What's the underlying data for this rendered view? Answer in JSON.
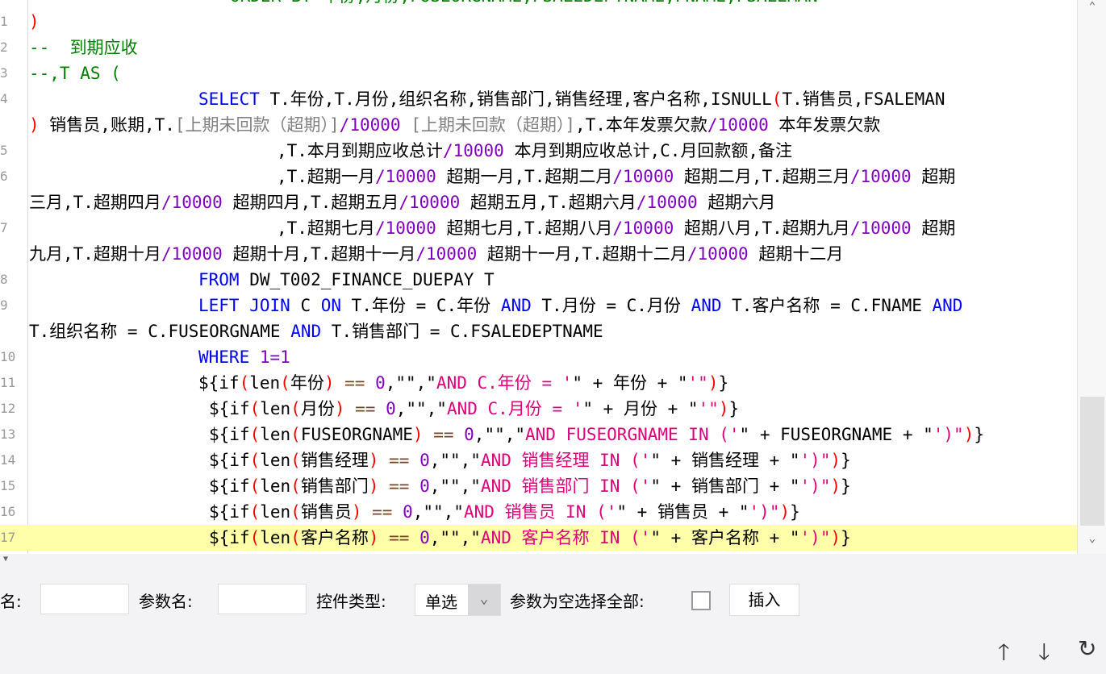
{
  "code": {
    "rows": [
      {
        "num": "",
        "tokens": [
          [
            "ORDER BY 年份,月份,FUSEORGNAME,FSALEDEPTNAME,FNAME,FSALEMAN",
            "cmt"
          ]
        ]
      },
      {
        "num": "1",
        "tokens": [
          [
            ")",
            "red"
          ]
        ]
      },
      {
        "num": "2",
        "tokens": [
          [
            "--  到期应收",
            "cmt"
          ]
        ]
      },
      {
        "num": "3",
        "tokens": [
          [
            "--,T AS (",
            "cmt"
          ]
        ]
      },
      {
        "num": "4",
        "tokens": [
          [
            "SELECT",
            "kw"
          ],
          [
            " T.年份,T.月份,组织名称,销售部门,销售经理,客户名称,ISNULL",
            "txt"
          ],
          [
            "(",
            "red"
          ],
          [
            "T.销售员,FSALEMAN",
            "txt"
          ]
        ]
      },
      {
        "num": "",
        "tokens": [
          [
            ")",
            "red"
          ],
          [
            " 销售员,账期,T.",
            "txt"
          ],
          [
            "[上期未回款（超期）]",
            "gray"
          ],
          [
            "/10000",
            "num"
          ],
          [
            " ",
            "txt"
          ],
          [
            "[上期未回款（超期）]",
            "gray"
          ],
          [
            ",T.本年发票欠款",
            "txt"
          ],
          [
            "/10000",
            "num"
          ],
          [
            " 本年发票欠款",
            "txt"
          ]
        ]
      },
      {
        "num": "5",
        "tokens": [
          [
            ",T.本月到期应收总计",
            "txt"
          ],
          [
            "/10000",
            "num"
          ],
          [
            " 本月到期应收总计,C.月回款额,备注",
            "txt"
          ]
        ]
      },
      {
        "num": "6",
        "tokens": [
          [
            ",T.超期一月",
            "txt"
          ],
          [
            "/10000",
            "num"
          ],
          [
            " 超期一月,T.超期二月",
            "txt"
          ],
          [
            "/10000",
            "num"
          ],
          [
            " 超期二月,T.超期三月",
            "txt"
          ],
          [
            "/10000",
            "num"
          ],
          [
            " 超期",
            "txt"
          ]
        ]
      },
      {
        "num": "",
        "tokens": [
          [
            "三月,T.超期四月",
            "txt"
          ],
          [
            "/10000",
            "num"
          ],
          [
            " 超期四月,T.超期五月",
            "txt"
          ],
          [
            "/10000",
            "num"
          ],
          [
            " 超期五月,T.超期六月",
            "txt"
          ],
          [
            "/10000",
            "num"
          ],
          [
            " 超期六月",
            "txt"
          ]
        ]
      },
      {
        "num": "7",
        "tokens": [
          [
            ",T.超期七月",
            "txt"
          ],
          [
            "/10000",
            "num"
          ],
          [
            " 超期七月,T.超期八月",
            "txt"
          ],
          [
            "/10000",
            "num"
          ],
          [
            " 超期八月,T.超期九月",
            "txt"
          ],
          [
            "/10000",
            "num"
          ],
          [
            " 超期",
            "txt"
          ]
        ]
      },
      {
        "num": "",
        "tokens": [
          [
            "九月,T.超期十月",
            "txt"
          ],
          [
            "/10000",
            "num"
          ],
          [
            " 超期十月,T.超期十一月",
            "txt"
          ],
          [
            "/10000",
            "num"
          ],
          [
            " 超期十一月,T.超期十二月",
            "txt"
          ],
          [
            "/10000",
            "num"
          ],
          [
            " 超期十二月",
            "txt"
          ]
        ]
      },
      {
        "num": "8",
        "tokens": [
          [
            "FROM",
            "kw"
          ],
          [
            " DW_T002_FINANCE_DUEPAY T",
            "txt"
          ]
        ]
      },
      {
        "num": "9",
        "tokens": [
          [
            "LEFT JOIN",
            "kw"
          ],
          [
            " C ",
            "txt"
          ],
          [
            "ON",
            "kw"
          ],
          [
            " T.年份 = C.年份 ",
            "txt"
          ],
          [
            "AND",
            "kw"
          ],
          [
            " T.月份 = C.月份 ",
            "txt"
          ],
          [
            "AND",
            "kw"
          ],
          [
            " T.客户名称 = C.FNAME ",
            "txt"
          ],
          [
            "AND",
            "kw"
          ]
        ]
      },
      {
        "num": "",
        "tokens": [
          [
            "T.组织名称 = C.FUSEORGNAME ",
            "txt"
          ],
          [
            "AND",
            "kw"
          ],
          [
            " T.销售部门 = C.FSALEDEPTNAME",
            "txt"
          ]
        ]
      },
      {
        "num": "10",
        "tokens": [
          [
            "WHERE",
            "kw"
          ],
          [
            " 1=1",
            "num"
          ]
        ]
      },
      {
        "num": "11",
        "tokens": [
          [
            "${if",
            "txt"
          ],
          [
            "(",
            "red"
          ],
          [
            "len",
            "txt"
          ],
          [
            "(",
            "red"
          ],
          [
            "年份",
            "txt"
          ],
          [
            ")",
            "red"
          ],
          [
            " == ",
            "op"
          ],
          [
            "0",
            "num"
          ],
          [
            ",\"\",\"",
            "txt"
          ],
          [
            "AND C.年份 = '",
            "str"
          ],
          [
            "\" + 年份 + \"",
            "txt"
          ],
          [
            "'\"",
            "str"
          ],
          [
            ")",
            "red"
          ],
          [
            "}",
            "txt"
          ]
        ]
      },
      {
        "num": "12",
        "tokens": [
          [
            "${if",
            "txt"
          ],
          [
            "(",
            "red"
          ],
          [
            "len",
            "txt"
          ],
          [
            "(",
            "red"
          ],
          [
            "月份",
            "txt"
          ],
          [
            ")",
            "red"
          ],
          [
            " == ",
            "op"
          ],
          [
            "0",
            "num"
          ],
          [
            ",\"\",\"",
            "txt"
          ],
          [
            "AND C.月份 = '",
            "str"
          ],
          [
            "\" + 月份 + \"",
            "txt"
          ],
          [
            "'\"",
            "str"
          ],
          [
            ")",
            "red"
          ],
          [
            "}",
            "txt"
          ]
        ]
      },
      {
        "num": "13",
        "tokens": [
          [
            "${if",
            "txt"
          ],
          [
            "(",
            "red"
          ],
          [
            "len",
            "txt"
          ],
          [
            "(",
            "red"
          ],
          [
            "FUSEORGNAME",
            "txt"
          ],
          [
            ")",
            "red"
          ],
          [
            " == ",
            "op"
          ],
          [
            "0",
            "num"
          ],
          [
            ",\"\",\"",
            "txt"
          ],
          [
            "AND FUSEORGNAME IN ('",
            "str"
          ],
          [
            "\" + FUSEORGNAME + \"",
            "txt"
          ],
          [
            "')\"",
            "str"
          ],
          [
            ")",
            "red"
          ],
          [
            "}",
            "txt"
          ]
        ]
      },
      {
        "num": "14",
        "tokens": [
          [
            "${if",
            "txt"
          ],
          [
            "(",
            "red"
          ],
          [
            "len",
            "txt"
          ],
          [
            "(",
            "red"
          ],
          [
            "销售经理",
            "txt"
          ],
          [
            ")",
            "red"
          ],
          [
            " == ",
            "op"
          ],
          [
            "0",
            "num"
          ],
          [
            ",\"\",\"",
            "txt"
          ],
          [
            "AND 销售经理 IN ('",
            "str"
          ],
          [
            "\" + 销售经理 + \"",
            "txt"
          ],
          [
            "')\"",
            "str"
          ],
          [
            ")",
            "red"
          ],
          [
            "}",
            "txt"
          ]
        ]
      },
      {
        "num": "15",
        "tokens": [
          [
            "${if",
            "txt"
          ],
          [
            "(",
            "red"
          ],
          [
            "len",
            "txt"
          ],
          [
            "(",
            "red"
          ],
          [
            "销售部门",
            "txt"
          ],
          [
            ")",
            "red"
          ],
          [
            " == ",
            "op"
          ],
          [
            "0",
            "num"
          ],
          [
            ",\"\",\"",
            "txt"
          ],
          [
            "AND 销售部门 IN ('",
            "str"
          ],
          [
            "\" + 销售部门 + \"",
            "txt"
          ],
          [
            "')\"",
            "str"
          ],
          [
            ")",
            "red"
          ],
          [
            "}",
            "txt"
          ]
        ]
      },
      {
        "num": "16",
        "tokens": [
          [
            "${if",
            "txt"
          ],
          [
            "(",
            "red"
          ],
          [
            "len",
            "txt"
          ],
          [
            "(",
            "red"
          ],
          [
            "销售员",
            "txt"
          ],
          [
            ")",
            "red"
          ],
          [
            " == ",
            "op"
          ],
          [
            "0",
            "num"
          ],
          [
            ",\"\",\"",
            "txt"
          ],
          [
            "AND 销售员 IN ('",
            "str"
          ],
          [
            "\" + 销售员 + \"",
            "txt"
          ],
          [
            "')\"",
            "str"
          ],
          [
            ")",
            "red"
          ],
          [
            "}",
            "txt"
          ]
        ]
      },
      {
        "num": "17",
        "tokens": [
          [
            "${if",
            "txt"
          ],
          [
            "(",
            "red"
          ],
          [
            "len",
            "txt"
          ],
          [
            "(",
            "red"
          ],
          [
            "客户名称",
            "txt"
          ],
          [
            ")",
            "red"
          ],
          [
            " == ",
            "op"
          ],
          [
            "0",
            "num"
          ],
          [
            ",\"\",\"",
            "txt"
          ],
          [
            "AND 客户名称 IN ('",
            "str"
          ],
          [
            "\" + 客户名称 + \"",
            "txt"
          ],
          [
            "')\"",
            "str"
          ],
          [
            ")",
            "red"
          ],
          [
            "}",
            "txt"
          ]
        ]
      }
    ]
  },
  "form": {
    "name_label": "名:",
    "param_name_label": "参数名:",
    "control_type_label": "控件类型:",
    "control_type_value": "单选",
    "empty_select_all_label": "参数为空选择全部:",
    "insert_label": "插入",
    "name_value": "",
    "param_name_value": ""
  },
  "icons": {
    "up": "move-up",
    "down": "move-down",
    "refresh": "refresh"
  }
}
